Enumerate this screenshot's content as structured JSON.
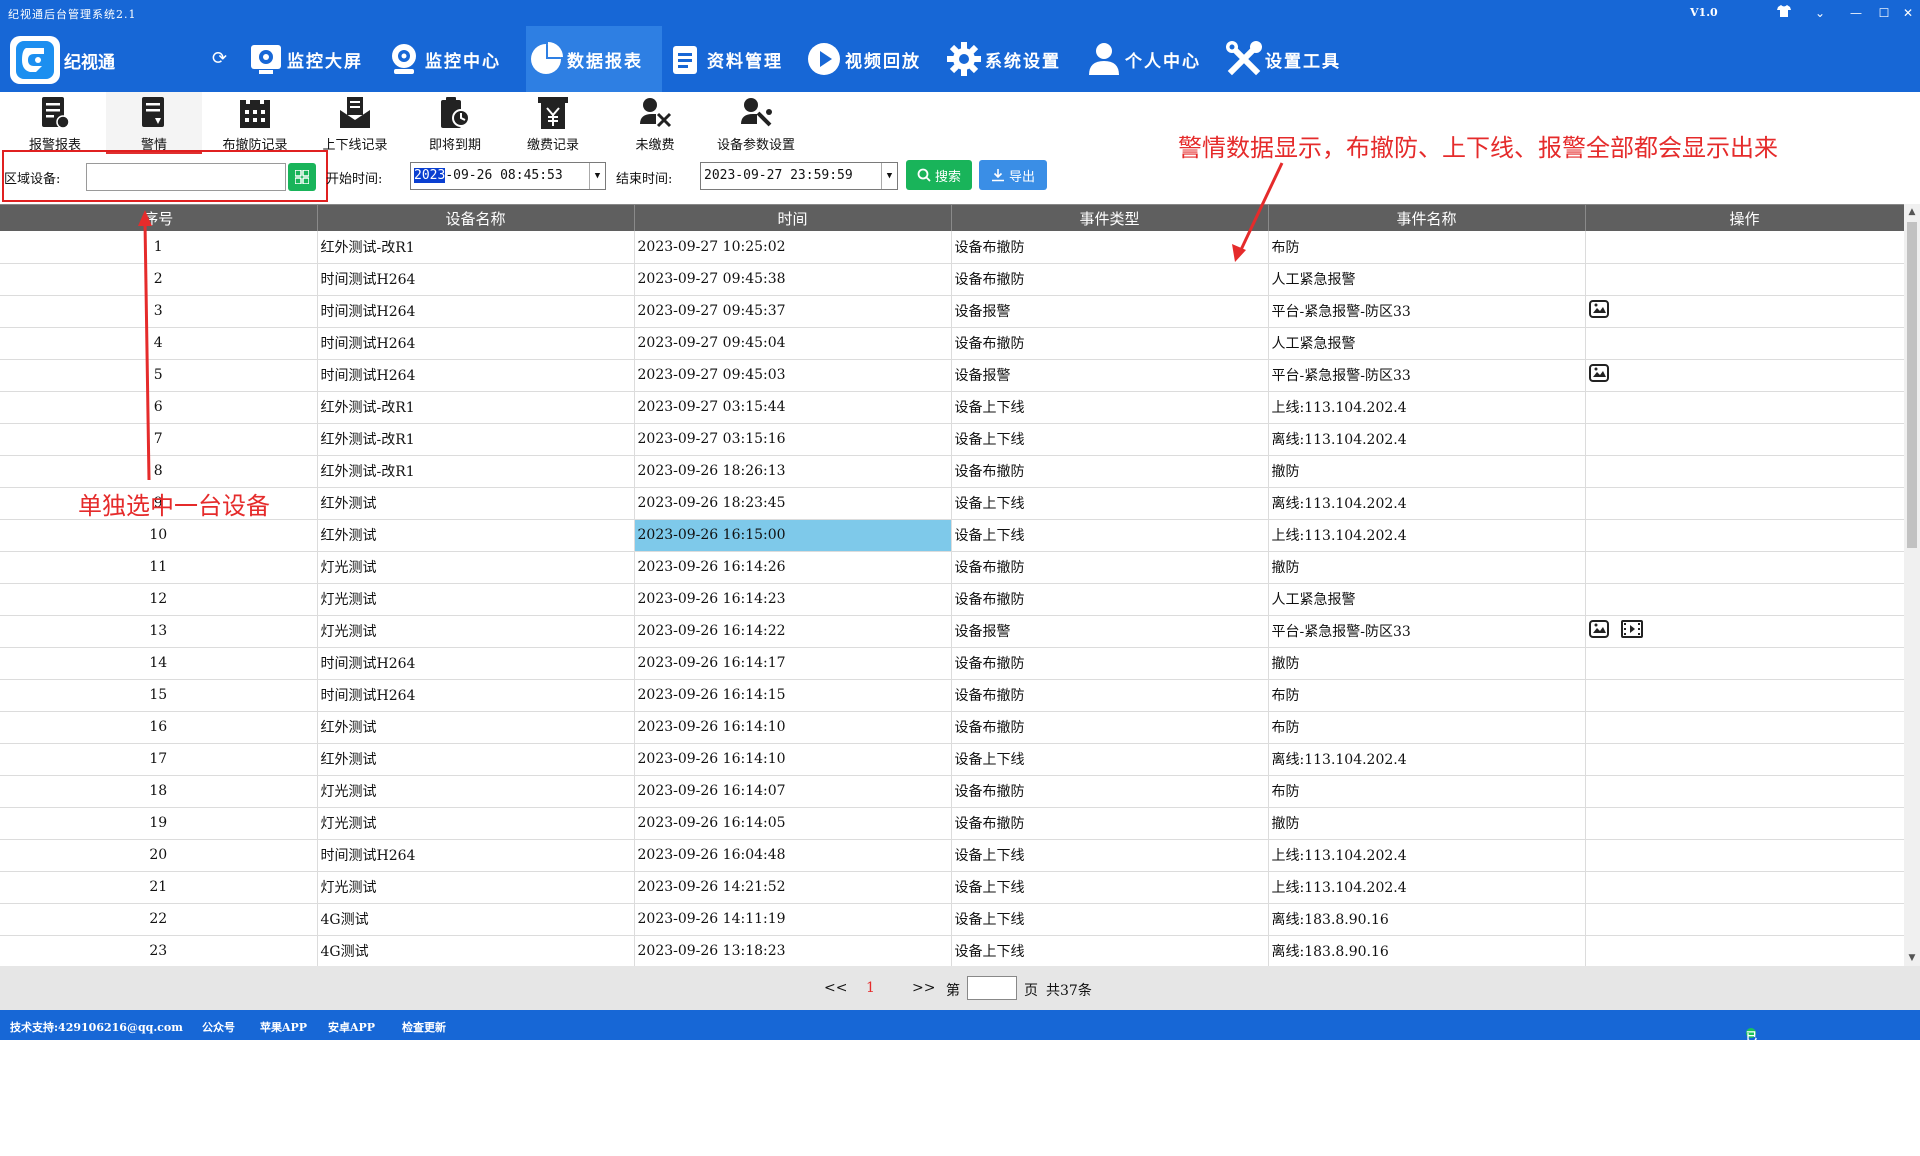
{
  "window": {
    "title": "纪视通后台管理系统2.1",
    "version": "V1.0",
    "buttons": [
      "⌄",
      "—",
      "☐",
      "✕"
    ]
  },
  "app": {
    "name": "纪视通"
  },
  "nav": [
    {
      "label": "监控大屏",
      "icon": "monitor-icon"
    },
    {
      "label": "监控中心",
      "icon": "camera-icon"
    },
    {
      "label": "数据报表",
      "icon": "pie-chart-icon",
      "active": true
    },
    {
      "label": "资料管理",
      "icon": "document-list-icon"
    },
    {
      "label": "视频回放",
      "icon": "play-icon"
    },
    {
      "label": "系统设置",
      "icon": "gear-icon"
    },
    {
      "label": "个人中心",
      "icon": "user-icon"
    },
    {
      "label": "设置工具",
      "icon": "tools-icon"
    }
  ],
  "subnav": [
    {
      "label": "报警报表",
      "icon": "report-icon"
    },
    {
      "label": "警情",
      "icon": "alert-doc-icon",
      "active": true
    },
    {
      "label": "布撤防记录",
      "icon": "castle-icon"
    },
    {
      "label": "上下线记录",
      "icon": "envelope-icon"
    },
    {
      "label": "即将到期",
      "icon": "clipboard-clock-icon"
    },
    {
      "label": "缴费记录",
      "icon": "yuan-icon"
    },
    {
      "label": "未缴费",
      "icon": "unpaid-icon"
    },
    {
      "label": "设备参数设置",
      "icon": "device-settings-icon"
    }
  ],
  "filters": {
    "region_label": "区域设备:",
    "region_value": "",
    "start_label": "开始时间:",
    "start_year": "2023",
    "start_rest": "-09-26 08:45:53",
    "end_label": "结束时间:",
    "end_value": "2023-09-27 23:59:59",
    "search_label": "搜索",
    "export_label": "导出"
  },
  "annotations": {
    "top_right": "警情数据显示，布撤防、上下线、报警全部都会显示出来",
    "left": "单独选中一台设备"
  },
  "table": {
    "columns": [
      "序号",
      "设备名称",
      "时间",
      "事件类型",
      "事件名称",
      "操作"
    ],
    "rows": [
      {
        "seq": "1",
        "device": "红外测试-改R1",
        "time": "2023-09-27 10:25:02",
        "type": "设备布撤防",
        "event": "布防",
        "ops": []
      },
      {
        "seq": "2",
        "device": "时间测试H264",
        "time": "2023-09-27 09:45:38",
        "type": "设备布撤防",
        "event": "人工紧急报警",
        "ops": []
      },
      {
        "seq": "3",
        "device": "时间测试H264",
        "time": "2023-09-27 09:45:37",
        "type": "设备报警",
        "event": "平台-紧急报警-防区33",
        "ops": [
          "image"
        ]
      },
      {
        "seq": "4",
        "device": "时间测试H264",
        "time": "2023-09-27 09:45:04",
        "type": "设备布撤防",
        "event": "人工紧急报警",
        "ops": []
      },
      {
        "seq": "5",
        "device": "时间测试H264",
        "time": "2023-09-27 09:45:03",
        "type": "设备报警",
        "event": "平台-紧急报警-防区33",
        "ops": [
          "image"
        ]
      },
      {
        "seq": "6",
        "device": "红外测试-改R1",
        "time": "2023-09-27 03:15:44",
        "type": "设备上下线",
        "event": "上线:113.104.202.4",
        "ops": []
      },
      {
        "seq": "7",
        "device": "红外测试-改R1",
        "time": "2023-09-27 03:15:16",
        "type": "设备上下线",
        "event": "离线:113.104.202.4",
        "ops": []
      },
      {
        "seq": "8",
        "device": "红外测试-改R1",
        "time": "2023-09-26 18:26:13",
        "type": "设备布撤防",
        "event": "撤防",
        "ops": []
      },
      {
        "seq": "9",
        "device": "红外测试",
        "time": "2023-09-26 18:23:45",
        "type": "设备上下线",
        "event": "离线:113.104.202.4",
        "ops": []
      },
      {
        "seq": "10",
        "device": "红外测试",
        "time": "2023-09-26 16:15:00",
        "type": "设备上下线",
        "event": "上线:113.104.202.4",
        "ops": [],
        "selected": true
      },
      {
        "seq": "11",
        "device": "灯光测试",
        "time": "2023-09-26 16:14:26",
        "type": "设备布撤防",
        "event": "撤防",
        "ops": []
      },
      {
        "seq": "12",
        "device": "灯光测试",
        "time": "2023-09-26 16:14:23",
        "type": "设备布撤防",
        "event": "人工紧急报警",
        "ops": []
      },
      {
        "seq": "13",
        "device": "灯光测试",
        "time": "2023-09-26 16:14:22",
        "type": "设备报警",
        "event": "平台-紧急报警-防区33",
        "ops": [
          "image",
          "video"
        ]
      },
      {
        "seq": "14",
        "device": "时间测试H264",
        "time": "2023-09-26 16:14:17",
        "type": "设备布撤防",
        "event": "撤防",
        "ops": []
      },
      {
        "seq": "15",
        "device": "时间测试H264",
        "time": "2023-09-26 16:14:15",
        "type": "设备布撤防",
        "event": "布防",
        "ops": []
      },
      {
        "seq": "16",
        "device": "红外测试",
        "time": "2023-09-26 16:14:10",
        "type": "设备布撤防",
        "event": "布防",
        "ops": []
      },
      {
        "seq": "17",
        "device": "红外测试",
        "time": "2023-09-26 16:14:10",
        "type": "设备上下线",
        "event": "离线:113.104.202.4",
        "ops": []
      },
      {
        "seq": "18",
        "device": "灯光测试",
        "time": "2023-09-26 16:14:07",
        "type": "设备布撤防",
        "event": "布防",
        "ops": []
      },
      {
        "seq": "19",
        "device": "灯光测试",
        "time": "2023-09-26 16:14:05",
        "type": "设备布撤防",
        "event": "撤防",
        "ops": []
      },
      {
        "seq": "20",
        "device": "时间测试H264",
        "time": "2023-09-26 16:04:48",
        "type": "设备上下线",
        "event": "上线:113.104.202.4",
        "ops": []
      },
      {
        "seq": "21",
        "device": "灯光测试",
        "time": "2023-09-26 14:21:52",
        "type": "设备上下线",
        "event": "上线:113.104.202.4",
        "ops": []
      },
      {
        "seq": "22",
        "device": "4G测试",
        "time": "2023-09-26 14:11:19",
        "type": "设备上下线",
        "event": "离线:183.8.90.16",
        "ops": []
      },
      {
        "seq": "23",
        "device": "4G测试",
        "time": "2023-09-26 13:18:23",
        "type": "设备上下线",
        "event": "离线:183.8.90.16",
        "ops": []
      }
    ]
  },
  "pager": {
    "first": "<<",
    "current": "1",
    "last": ">>",
    "page_prefix": "第",
    "page_suffix": "页",
    "total": "共37条"
  },
  "status": {
    "support": "技术支持:429106216@qq.com",
    "official": "公众号",
    "apple": "苹果APP",
    "android": "安卓APP",
    "update": "检查更新",
    "connection": "已经连接至数据库"
  },
  "colors": {
    "primary": "#1767d6",
    "accent_red": "#e52b2b",
    "success_green": "#19b45a",
    "selected_cell": "#7ec9ea"
  }
}
